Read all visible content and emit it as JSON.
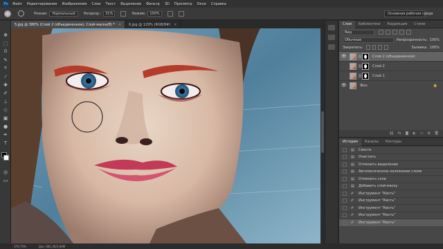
{
  "menu": {
    "logo": "Ps",
    "items": [
      "Файл",
      "Редактирование",
      "Изображение",
      "Слои",
      "Текст",
      "Выделение",
      "Фильтр",
      "3D",
      "Просмотр",
      "Окно",
      "Справка"
    ]
  },
  "options": {
    "mode_label": "Режим:",
    "mode_value": "Нормальный",
    "opacity_label": "Непрозр.:",
    "opacity_value": "31%",
    "pressure_label": "Нажим:",
    "pressure_value": "100%",
    "workspace": "Основная рабочая среда"
  },
  "tabs": [
    {
      "label": "5.jpg @ 380% (Слой 2 (объединенное), Слой-маска/8) *",
      "close": "×"
    },
    {
      "label": "6.jpg @ 129% (RGB/8#)",
      "close": "×"
    }
  ],
  "status": {
    "zoom": "379,75%",
    "doc": "Док: 681,3K/3,66М"
  },
  "layers_panel": {
    "tabs": [
      "Слои",
      "Библиотеки",
      "Коррекция",
      "Стили"
    ],
    "filter_label": "Вид",
    "blend_mode": "Обычные",
    "opacity_label": "Непрозрачность:",
    "opacity_value": "100%",
    "lock_label": "Закрепить:",
    "fill_label": "Заливка:",
    "fill_value": "100%",
    "layers": [
      {
        "name": "Слой 2 (объединенное)",
        "visible": true,
        "selected": true,
        "mask": true
      },
      {
        "name": "Слой 2",
        "visible": false,
        "selected": false,
        "mask": true
      },
      {
        "name": "Слой 1",
        "visible": false,
        "selected": false,
        "mask": true
      },
      {
        "name": "Фон",
        "visible": true,
        "selected": false,
        "mask": false
      }
    ],
    "bottom_icons": [
      "link-icon",
      "fx-icon",
      "mask-icon",
      "adjust-icon",
      "folder-icon",
      "new-layer-icon",
      "trash-icon"
    ]
  },
  "history_panel": {
    "tabs": [
      "История",
      "Каналы",
      "Контуры"
    ],
    "items": [
      "Свести",
      "Очистить",
      "Отменить выделение",
      "Автоматическое наложение слоев",
      "Отменить слои",
      "Добавить слой-маску",
      "Инструмент \"Кисть\"",
      "Инструмент \"Кисть\"",
      "Инструмент \"Кисть\"",
      "Инструмент \"Кисть\"",
      "Инструмент \"Кисть\""
    ]
  }
}
